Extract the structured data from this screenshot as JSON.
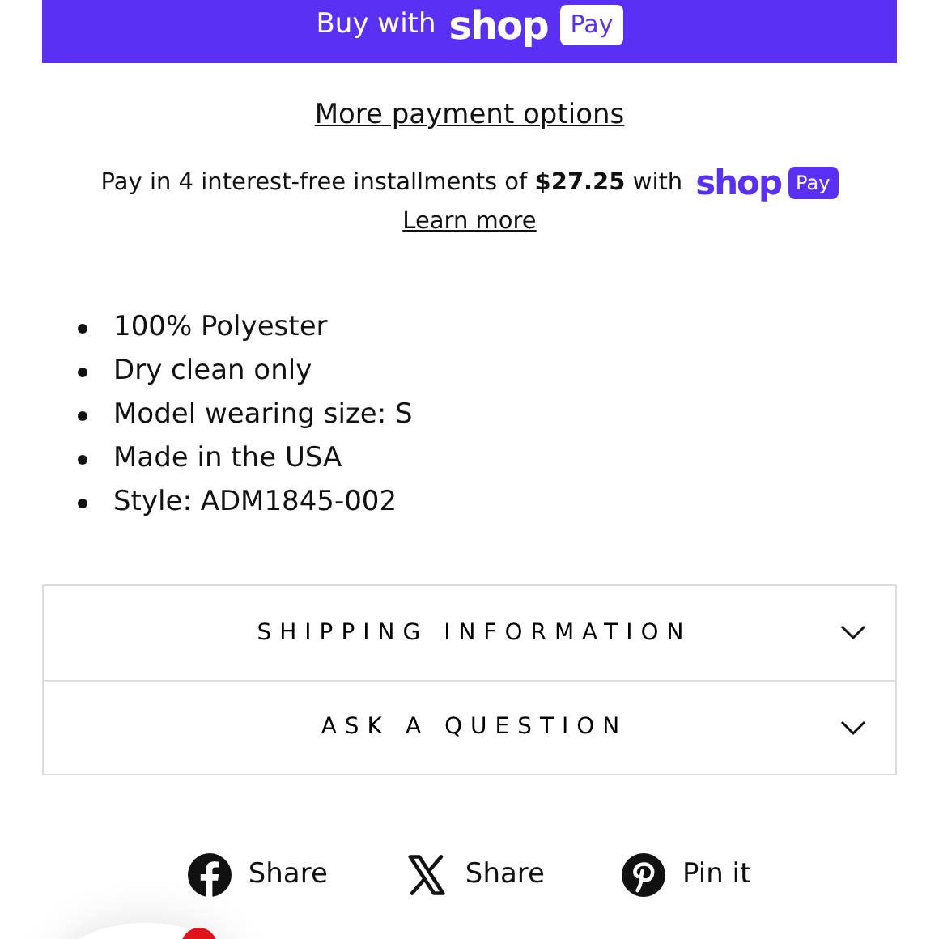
{
  "buy_button": {
    "label": "Buy with",
    "logo": "shop",
    "badge": "Pay"
  },
  "more_payment_options": "More payment options",
  "installments": {
    "text": "Pay in 4 interest-free installments of **$27.25** with",
    "logo": "shop",
    "badge": "Pay",
    "link": "Learn more"
  },
  "details": [
    "100% Polyester",
    "Dry clean only",
    "Model wearing size: S",
    "Made in the USA",
    "Style: ADM1845-002"
  ],
  "accordion": [
    {
      "title": "SHIPPING INFORMATION",
      "expanded": false
    },
    {
      "title": "ASK A QUESTION",
      "expanded": false
    }
  ],
  "share": [
    {
      "kind": "facebook",
      "label": "Share"
    },
    {
      "kind": "x",
      "label": "Share"
    },
    {
      "kind": "pinterest",
      "label": "Pin it"
    }
  ]
}
